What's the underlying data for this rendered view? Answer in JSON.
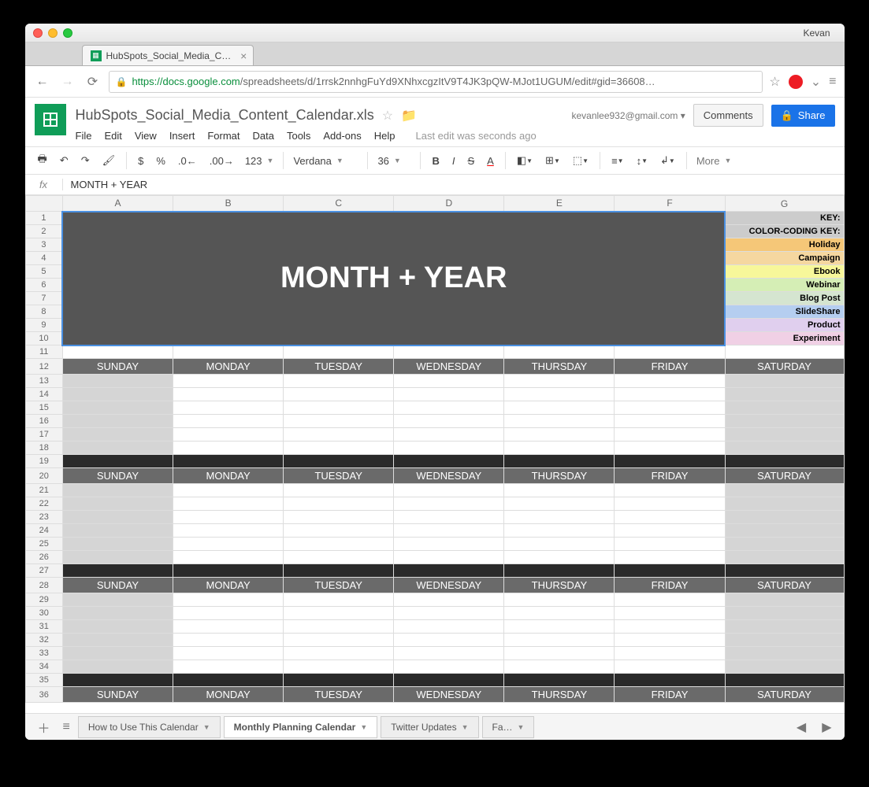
{
  "browser": {
    "profile": "Kevan",
    "tab_title": "HubSpots_Social_Media_C…",
    "url_domain": "https://docs.google.com",
    "url_path": "/spreadsheets/d/1rrsk2nnhgFuYd9XNhxcgzItV9T4JK3pQW-MJot1UGUM/edit#gid=36608…"
  },
  "docs": {
    "title": "HubSpots_Social_Media_Content_Calendar.xls",
    "email": "kevanlee932@gmail.com",
    "comments_label": "Comments",
    "share_label": "Share",
    "menu": [
      "File",
      "Edit",
      "View",
      "Insert",
      "Format",
      "Data",
      "Tools",
      "Add-ons",
      "Help"
    ],
    "last_edit": "Last edit was seconds ago"
  },
  "toolbar": {
    "currency": "$",
    "percent": "%",
    "dec_minus": ".0",
    "dec_plus": ".00",
    "num_fmt": "123",
    "font": "Verdana",
    "size": "36",
    "bold": "B",
    "italic": "I",
    "strike": "S",
    "more": "More"
  },
  "formula": {
    "label": "fx",
    "value": "MONTH + YEAR"
  },
  "columns": [
    "A",
    "B",
    "C",
    "D",
    "E",
    "F",
    "G"
  ],
  "rows": [
    1,
    2,
    3,
    4,
    5,
    6,
    7,
    8,
    9,
    10,
    11,
    12,
    13,
    14,
    15,
    16,
    17,
    18,
    19,
    20,
    21,
    22,
    23,
    24,
    25,
    26,
    27,
    28,
    29,
    30,
    31,
    32,
    33,
    34,
    35,
    36
  ],
  "merged_title": "MONTH + YEAR",
  "key": {
    "header1": "KEY:",
    "header2": "COLOR-CODING KEY:",
    "items": [
      {
        "label": "Holiday",
        "cls": "key-holiday"
      },
      {
        "label": "Campaign",
        "cls": "key-campaign"
      },
      {
        "label": "Ebook",
        "cls": "key-ebook"
      },
      {
        "label": "Webinar",
        "cls": "key-webinar"
      },
      {
        "label": "Blog Post",
        "cls": "key-blogpost"
      },
      {
        "label": "SlideShare",
        "cls": "key-slideshare"
      },
      {
        "label": "Product",
        "cls": "key-product"
      },
      {
        "label": "Experiment",
        "cls": "key-experiment"
      }
    ]
  },
  "days": [
    "SUNDAY",
    "MONDAY",
    "TUESDAY",
    "WEDNESDAY",
    "THURSDAY",
    "FRIDAY",
    "SATURDAY"
  ],
  "sheet_tabs": {
    "items": [
      {
        "label": "How to Use This Calendar",
        "active": false
      },
      {
        "label": "Monthly Planning Calendar",
        "active": true
      },
      {
        "label": "Twitter Updates",
        "active": false
      },
      {
        "label": "Fa…",
        "active": false
      }
    ]
  }
}
